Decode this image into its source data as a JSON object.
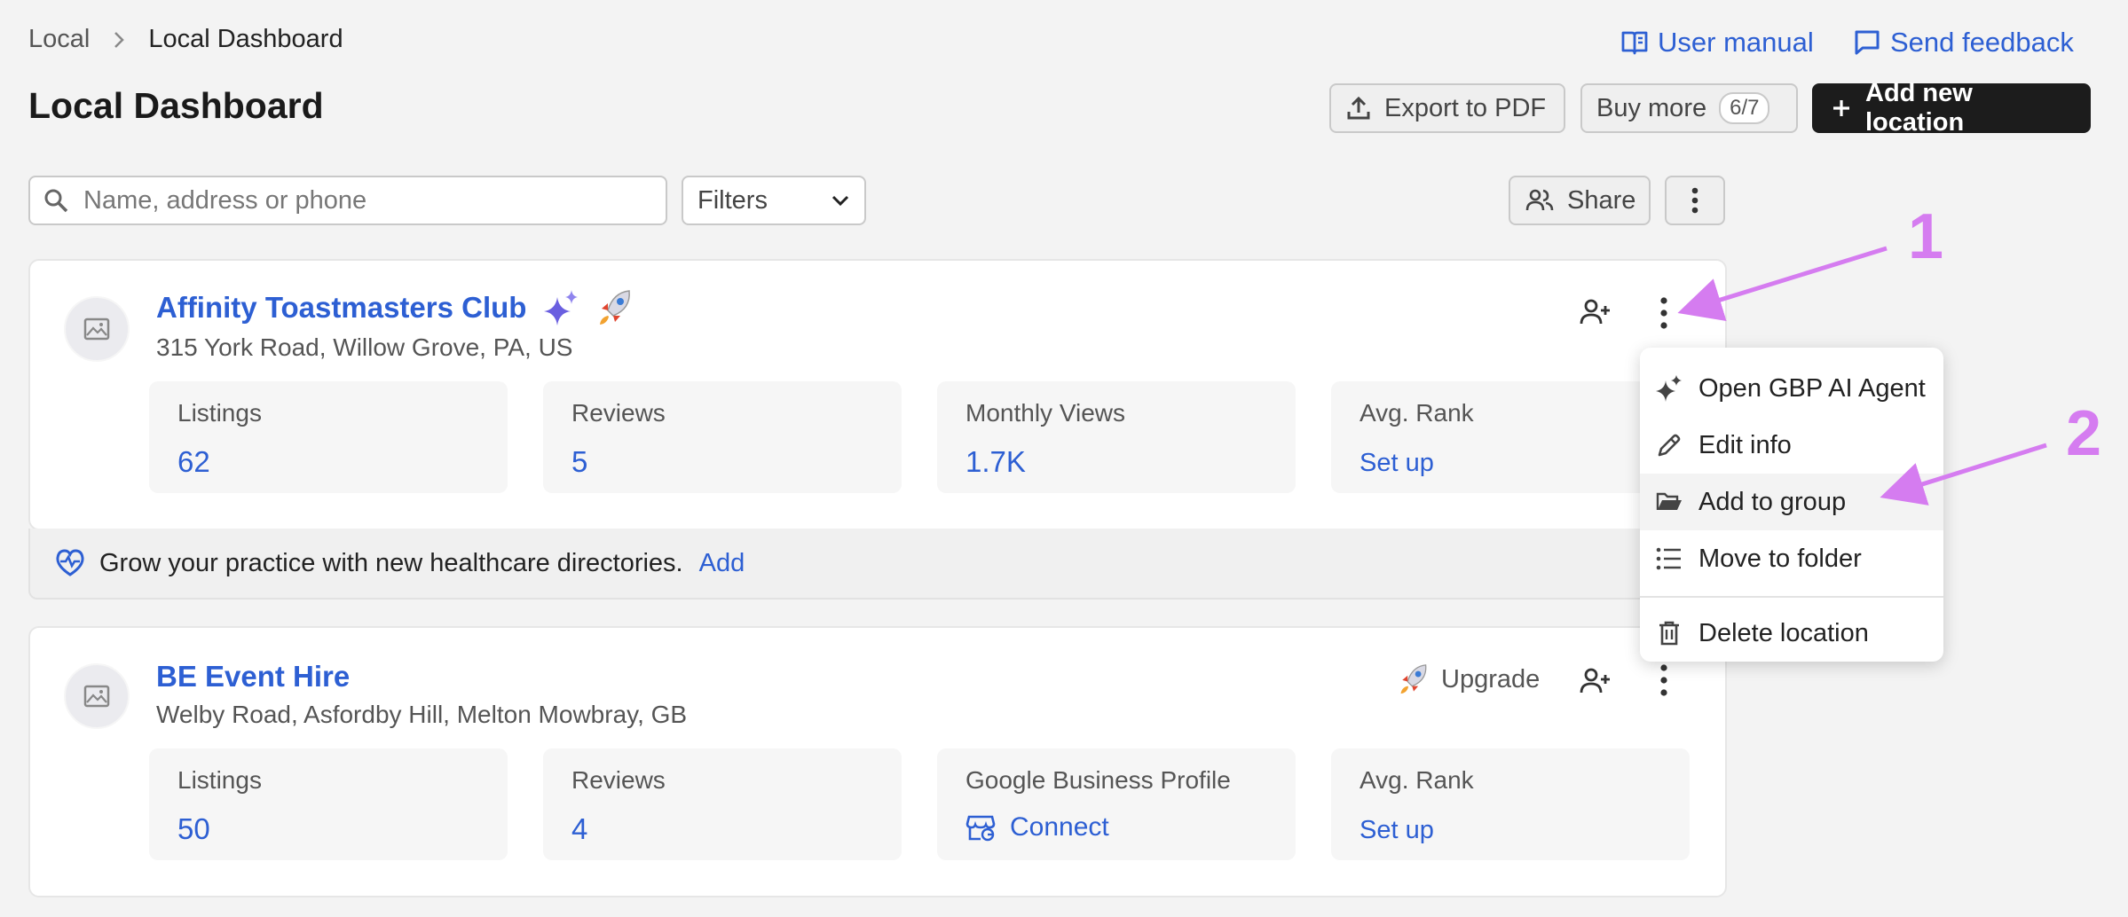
{
  "breadcrumb": {
    "root": "Local",
    "current": "Local Dashboard"
  },
  "page_title": "Local Dashboard",
  "top_links": {
    "manual": "User manual",
    "feedback": "Send feedback"
  },
  "toolbar": {
    "export": "Export to PDF",
    "buy_more": "Buy more",
    "buy_count": "6/7",
    "add_location": "Add new location"
  },
  "search": {
    "placeholder": "Name, address or phone",
    "value": ""
  },
  "filters": {
    "label": "Filters"
  },
  "share": {
    "label": "Share"
  },
  "locations": [
    {
      "name": "Affinity Toastmasters Club",
      "address": "315 York Road, Willow Grove, PA, US",
      "metrics": [
        {
          "label": "Listings",
          "value": "62"
        },
        {
          "label": "Reviews",
          "value": "5"
        },
        {
          "label": "Monthly Views",
          "value": "1.7K"
        },
        {
          "label": "Avg. Rank",
          "value": "Set up"
        }
      ]
    },
    {
      "name": "BE Event Hire",
      "address": "Welby Road, Asfordby Hill, Melton Mowbray, GB",
      "upgrade": "Upgrade",
      "metrics": [
        {
          "label": "Listings",
          "value": "50"
        },
        {
          "label": "Reviews",
          "value": "4"
        },
        {
          "label": "Google Business Profile",
          "value": "Connect"
        },
        {
          "label": "Avg. Rank",
          "value": "Set up"
        }
      ]
    }
  ],
  "banner": {
    "text": "Grow your practice with new healthcare directories.",
    "link": "Add"
  },
  "context_menu": {
    "items": [
      {
        "label": "Open GBP AI Agent",
        "icon": "sparkle-icon"
      },
      {
        "label": "Edit info",
        "icon": "pencil-icon"
      },
      {
        "label": "Add to group",
        "icon": "folder-open-icon"
      },
      {
        "label": "Move to folder",
        "icon": "list-icon"
      },
      {
        "label": "Delete location",
        "icon": "trash-icon"
      }
    ]
  },
  "annotations": {
    "first": "1",
    "second": "2"
  },
  "colors": {
    "accent": "#2d5fd3",
    "annotation": "#d57cf0",
    "dark_button": "#1c1c1c"
  }
}
